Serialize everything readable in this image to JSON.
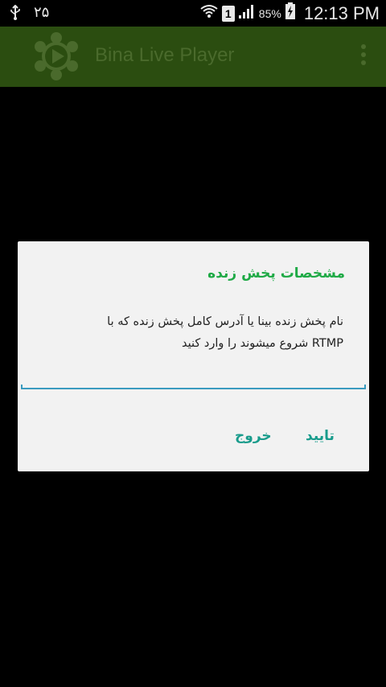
{
  "status_bar": {
    "notification_number": "۲۵",
    "sim_slot": "1",
    "battery_percent": "85%",
    "time": "12:13 PM",
    "icons": [
      "usb-icon",
      "wifi-icon",
      "sim-icon",
      "signal-icon",
      "battery-charging-icon"
    ]
  },
  "app_bar": {
    "title": "Bina Live Player",
    "color": "#2b4d10",
    "icons": [
      "app-logo-icon",
      "overflow-menu-icon"
    ]
  },
  "dialog": {
    "title": "مشخصات پخش زنده",
    "message_line1": "نام پخش زنده بینا یا آدرس  کامل پخش زنده که با",
    "message_line2": "RTMP شروع میشوند را وارد کنید",
    "input_value": "",
    "confirm_label": "تایید",
    "exit_label": "خروج",
    "accent_title": "#1faa46",
    "accent_buttons": "#199c8c"
  }
}
